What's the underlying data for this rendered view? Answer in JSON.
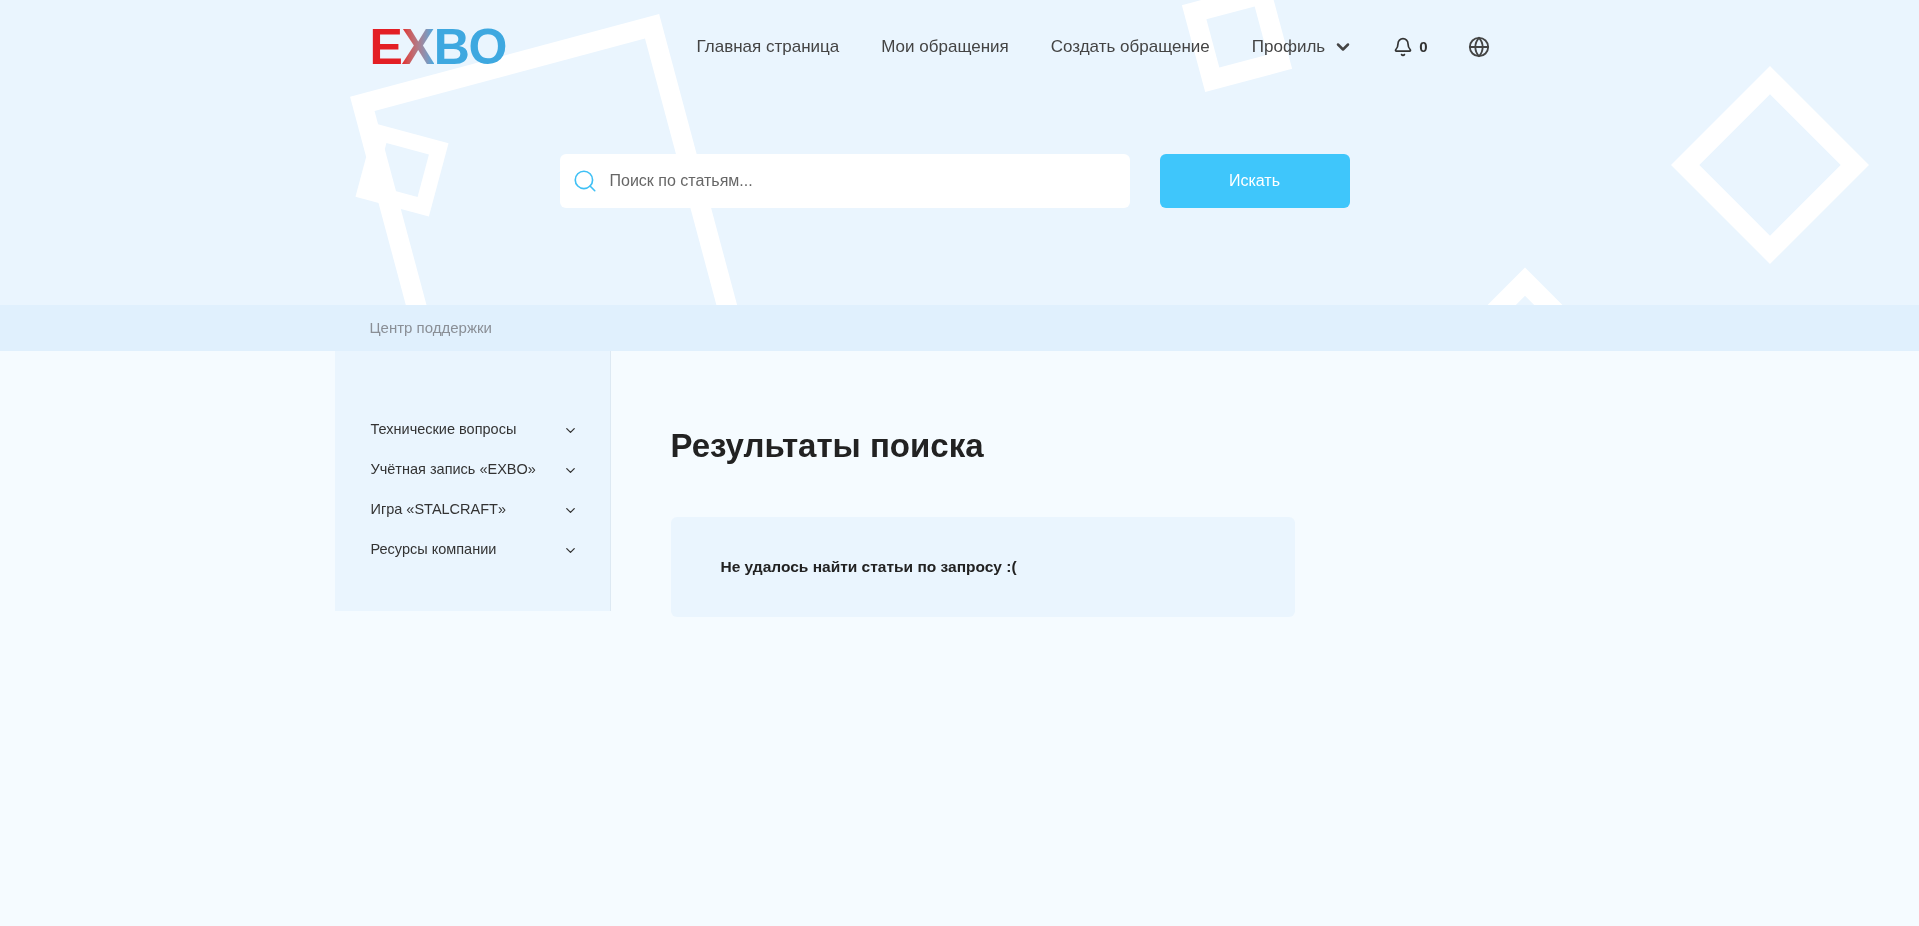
{
  "logo": {
    "text": "EXBO"
  },
  "nav": [
    {
      "label": "Главная страница"
    },
    {
      "label": "Мои обращения"
    },
    {
      "label": "Создать обращение"
    }
  ],
  "profile": {
    "label": "Профиль",
    "expanded": false
  },
  "notifications": {
    "count": "0"
  },
  "search": {
    "placeholder": "Поиск по статьям...",
    "button": "Искать"
  },
  "breadcrumb": "Центр поддержки",
  "sidebar": {
    "items": [
      {
        "label": "Технические вопросы",
        "expanded": false
      },
      {
        "label": "Учётная запись «EXBO»",
        "expanded": false
      },
      {
        "label": "Игра «STALCRAFT»",
        "expanded": false
      },
      {
        "label": "Ресурсы компании",
        "expanded": false
      }
    ]
  },
  "results": {
    "title": "Результаты поиска",
    "message": "Не удалось найти статьи по запросу :("
  }
}
